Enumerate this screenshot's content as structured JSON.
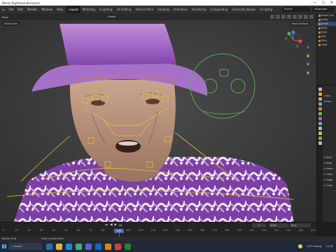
{
  "window": {
    "title": "Blend_Rig\\Alexander.blend",
    "controls": [
      "—",
      "▢",
      "✕"
    ]
  },
  "menu": [
    "File",
    "Edit",
    "Render",
    "Window",
    "Help"
  ],
  "workspaces": [
    {
      "label": "Layout",
      "active": true
    },
    {
      "label": "Modeling",
      "active": false
    },
    {
      "label": "Sculpting",
      "active": false
    },
    {
      "label": "UV Editing",
      "active": false
    },
    {
      "label": "Texture Paint",
      "active": false
    },
    {
      "label": "Shading",
      "active": false
    },
    {
      "label": "Animation",
      "active": false
    },
    {
      "label": "Rendering",
      "active": false
    },
    {
      "label": "Compositing",
      "active": false
    },
    {
      "label": "Geometry Nodes",
      "active": false
    },
    {
      "label": "Scripting",
      "active": false
    }
  ],
  "scene_field": "Scene",
  "view_layer_field": "ViewLayer",
  "viewport": {
    "mode": "Pose",
    "select_box": "Select Box",
    "orientation": "Global",
    "pose_options": "Pose Options",
    "nav_buttons": [
      "+",
      "✋",
      "⌘",
      "▦"
    ]
  },
  "outliner": {
    "rows": [
      {
        "label": "Scene Coll",
        "color": "#9a9a9a"
      },
      {
        "label": "Collec",
        "color": "#9a9a9a"
      },
      {
        "label": "Armat",
        "color": "#e38a2c"
      },
      {
        "label": "Body",
        "color": "#e38a2c"
      },
      {
        "label": "Eyes",
        "color": "#e38a2c"
      },
      {
        "label": "Hat",
        "color": "#e38a2c"
      },
      {
        "label": "Shirt",
        "color": "#e38a2c"
      },
      {
        "label": "Light",
        "color": "#e38a2c"
      }
    ]
  },
  "properties": {
    "tabs_colors": [
      "#b9b9b9",
      "#d7a54d",
      "#d7a54d",
      "#6aa3d8",
      "#d17b5b",
      "#6ab36a",
      "#c05aa8",
      "#6aa3d8",
      "#b9b9b9",
      "#e0b050",
      "#6ab36a",
      "#b9b9b9"
    ],
    "lines": [
      "",
      "> Bon",
      "v Trans",
      "",
      "",
      "",
      "",
      "",
      "",
      "",
      "",
      "",
      "> Bend",
      "> Relat",
      "> Invers",
      "> Custo",
      "> Viewp",
      "> Custo"
    ]
  },
  "timeline": {
    "controls": [
      "⏮",
      "◀",
      "▶",
      "⏭"
    ],
    "current_frame": "1",
    "start": "Start",
    "end": "End",
    "ruler": [
      {
        "label": "0"
      },
      {
        "label": "10"
      },
      {
        "label": "20"
      },
      {
        "label": "30"
      },
      {
        "label": "40"
      },
      {
        "label": "50"
      },
      {
        "label": "60"
      },
      {
        "label": "70"
      },
      {
        "label": "80"
      },
      {
        "label": "90"
      },
      {
        "label": "100"
      },
      {
        "label": "110"
      },
      {
        "label": "120"
      },
      {
        "label": "130"
      },
      {
        "label": "140"
      },
      {
        "label": "150"
      },
      {
        "label": "160"
      },
      {
        "label": "170"
      },
      {
        "label": "180"
      },
      {
        "label": "190"
      },
      {
        "label": "200"
      },
      {
        "label": "210"
      },
      {
        "label": "220"
      },
      {
        "label": "230"
      },
      {
        "label": "240"
      },
      {
        "label": "250"
      }
    ],
    "playhead": "120"
  },
  "statusbar": [
    "Rotate View",
    "",
    "Pose Context Menu"
  ],
  "taskbar": {
    "search_placeholder": "Search",
    "app_colors": [
      "#2b6cb0",
      "#e8b13a",
      "#1f8ad3",
      "#3cb371",
      "#5e5ecf",
      "#1565c0",
      "#e87d0d",
      "#d13f3f",
      "#2e7d32"
    ],
    "weather": "10°C  Sunny",
    "time": "11:24"
  },
  "accent": "#4772b3"
}
